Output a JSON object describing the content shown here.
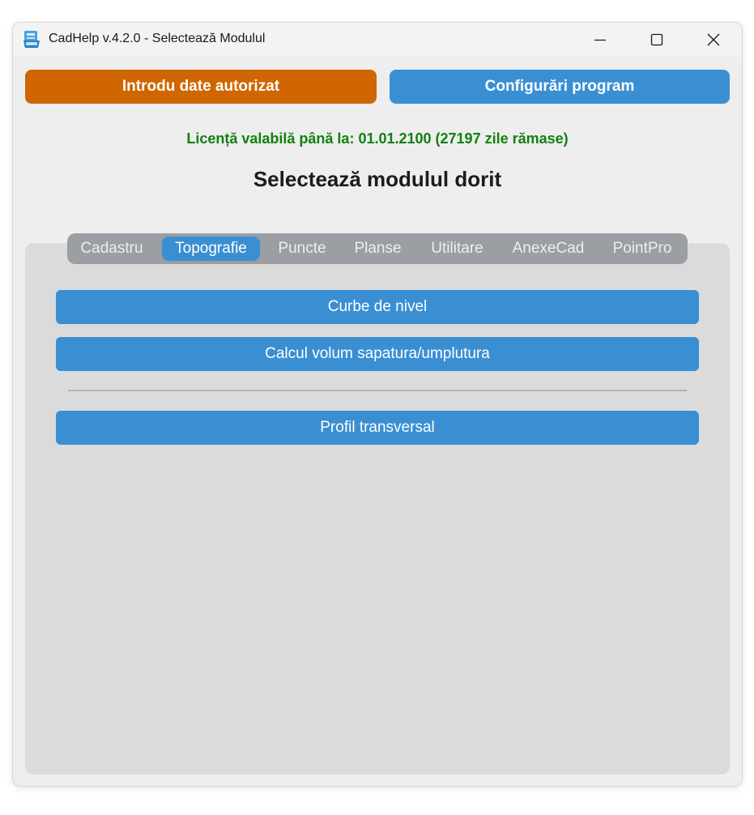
{
  "window": {
    "title": "CadHelp v.4.2.0 - Selectează Modulul",
    "app_icon": "cadhelp-app-icon",
    "controls": {
      "minimize_icon": "minimize-icon",
      "maximize_icon": "maximize-icon",
      "close_icon": "close-icon"
    }
  },
  "header": {
    "auth_button_label": "Introdu date autorizat",
    "config_button_label": "Configurări program"
  },
  "license_text": "Licență valabilă până la: 01.01.2100 (27197 zile rămase)",
  "page_title": "Selectează modulul dorit",
  "tabs": [
    {
      "label": "Cadastru",
      "active": false
    },
    {
      "label": "Topografie",
      "active": true
    },
    {
      "label": "Puncte",
      "active": false
    },
    {
      "label": "Planse",
      "active": false
    },
    {
      "label": "Utilitare",
      "active": false
    },
    {
      "label": "AnexeCad",
      "active": false
    },
    {
      "label": "PointPro",
      "active": false
    }
  ],
  "modules": {
    "curbe_label": "Curbe de nivel",
    "calcul_label": "Calcul volum sapatura/umplutura",
    "profil_label": "Profil transversal"
  },
  "colors": {
    "accent_blue": "#3a8fd3",
    "accent_orange": "#cf6600",
    "license_green": "#12800f",
    "tabbar_gray": "#9b9ea3",
    "panel_gray": "#dbdbdb",
    "window_bg": "#eeeeee"
  }
}
